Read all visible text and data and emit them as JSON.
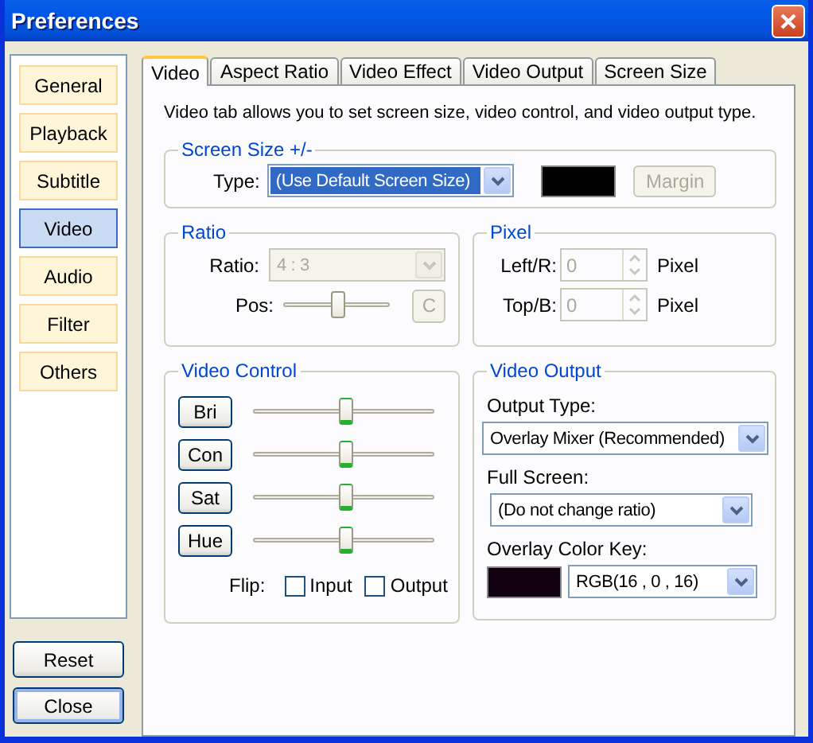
{
  "window": {
    "title": "Preferences"
  },
  "sidebar": {
    "items": [
      {
        "label": "General",
        "selected": false
      },
      {
        "label": "Playback",
        "selected": false
      },
      {
        "label": "Subtitle",
        "selected": false
      },
      {
        "label": "Video",
        "selected": true
      },
      {
        "label": "Audio",
        "selected": false
      },
      {
        "label": "Filter",
        "selected": false
      },
      {
        "label": "Others",
        "selected": false
      }
    ],
    "buttons": [
      {
        "label": "Reset",
        "focused": false
      },
      {
        "label": "Close",
        "focused": true
      }
    ]
  },
  "tabs": [
    {
      "label": "Video",
      "selected": true
    },
    {
      "label": "Aspect Ratio",
      "selected": false
    },
    {
      "label": "Video Effect",
      "selected": false
    },
    {
      "label": "Video Output",
      "selected": false
    },
    {
      "label": "Screen Size",
      "selected": false
    }
  ],
  "description": "Video tab allows you to set screen size, video control, and video output type.",
  "screen_size": {
    "title": "Screen Size +/-",
    "type_label": "Type:",
    "type_value": "(Use Default Screen Size)",
    "margin_button": {
      "label": "Margin",
      "disabled": true
    }
  },
  "ratio": {
    "title": "Ratio",
    "ratio_label": "Ratio:",
    "ratio_value": "4 : 3",
    "disabled": true,
    "pos_label": "Pos:",
    "pos_slider": {
      "level": 0.5
    },
    "reset_button": "C"
  },
  "pixel": {
    "title": "Pixel",
    "rows": [
      {
        "label": "Left/R:",
        "value": "0",
        "unit": "Pixel",
        "disabled": true
      },
      {
        "label": "Top/B:",
        "value": "0",
        "unit": "Pixel",
        "disabled": true
      }
    ]
  },
  "video_control": {
    "title": "Video Control",
    "sliders": [
      {
        "button": "Bri",
        "level": 0.51
      },
      {
        "button": "Con",
        "level": 0.51
      },
      {
        "button": "Sat",
        "level": 0.51
      },
      {
        "button": "Hue",
        "level": 0.51
      }
    ],
    "flip_label": "Flip:",
    "flip": [
      {
        "label": "Input",
        "checked": false
      },
      {
        "label": "Output",
        "checked": false
      }
    ]
  },
  "video_output": {
    "title": "Video Output",
    "fields": [
      {
        "label": "Output Type:",
        "value": "Overlay Mixer (Recommended)"
      },
      {
        "label": "Full Screen:",
        "value": "(Do not change ratio)"
      }
    ],
    "color_key": {
      "label": "Overlay Color Key:",
      "value": "RGB(16 , 0 , 16)"
    }
  }
}
